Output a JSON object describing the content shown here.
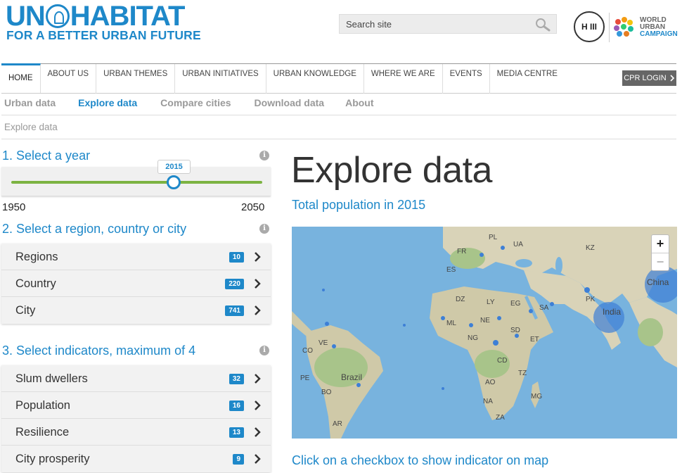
{
  "header": {
    "logo_un": "UN",
    "logo_habitat": "HABITAT",
    "logo_tagline": "FOR A BETTER URBAN FUTURE",
    "search_placeholder": "Search site",
    "badge_text": "H III",
    "wuc_world": "WORLD",
    "wuc_urban": "URBAN",
    "wuc_campaign": "CAMPAIGN",
    "brand_color": "#1e88c9"
  },
  "main_nav": {
    "items": [
      "HOME",
      "ABOUT US",
      "URBAN THEMES",
      "URBAN INITIATIVES",
      "URBAN KNOWLEDGE",
      "WHERE WE ARE",
      "EVENTS",
      "MEDIA CENTRE"
    ],
    "active": "HOME",
    "cpr_login": "CPR LOGIN"
  },
  "sub_nav": {
    "items": [
      "Urban data",
      "Explore data",
      "Compare cities",
      "Download data",
      "About"
    ],
    "active": "Explore data"
  },
  "breadcrumb": "Explore data",
  "sidebar": {
    "step1_title": "1. Select a year",
    "year_selected": "2015",
    "year_min": "1950",
    "year_max": "2050",
    "step2_title": "2. Select a region, country or city",
    "locations": [
      {
        "label": "Regions",
        "count": "10"
      },
      {
        "label": "Country",
        "count": "220"
      },
      {
        "label": "City",
        "count": "741"
      }
    ],
    "step3_title": "3. Select indicators, maximum of 4",
    "indicators": [
      {
        "label": "Slum dwellers",
        "count": "32"
      },
      {
        "label": "Population",
        "count": "16"
      },
      {
        "label": "Resilience",
        "count": "13"
      },
      {
        "label": "City prosperity",
        "count": "9"
      }
    ]
  },
  "main": {
    "title": "Explore data",
    "subtitle": "Total population in 2015",
    "zoom_in": "+",
    "zoom_out": "−",
    "hint": "Click on a checkbox to show indicator on map",
    "map_labels": [
      "KZ",
      "UA",
      "PL",
      "FR",
      "ES",
      "DZ",
      "LY",
      "EG",
      "SA",
      "PK",
      "ML",
      "NE",
      "SD",
      "NG",
      "ET",
      "CD",
      "TZ",
      "AO",
      "NA",
      "ZA",
      "MG",
      "VE",
      "CO",
      "PE",
      "BO",
      "AR",
      "China",
      "India",
      "Brazil"
    ]
  }
}
